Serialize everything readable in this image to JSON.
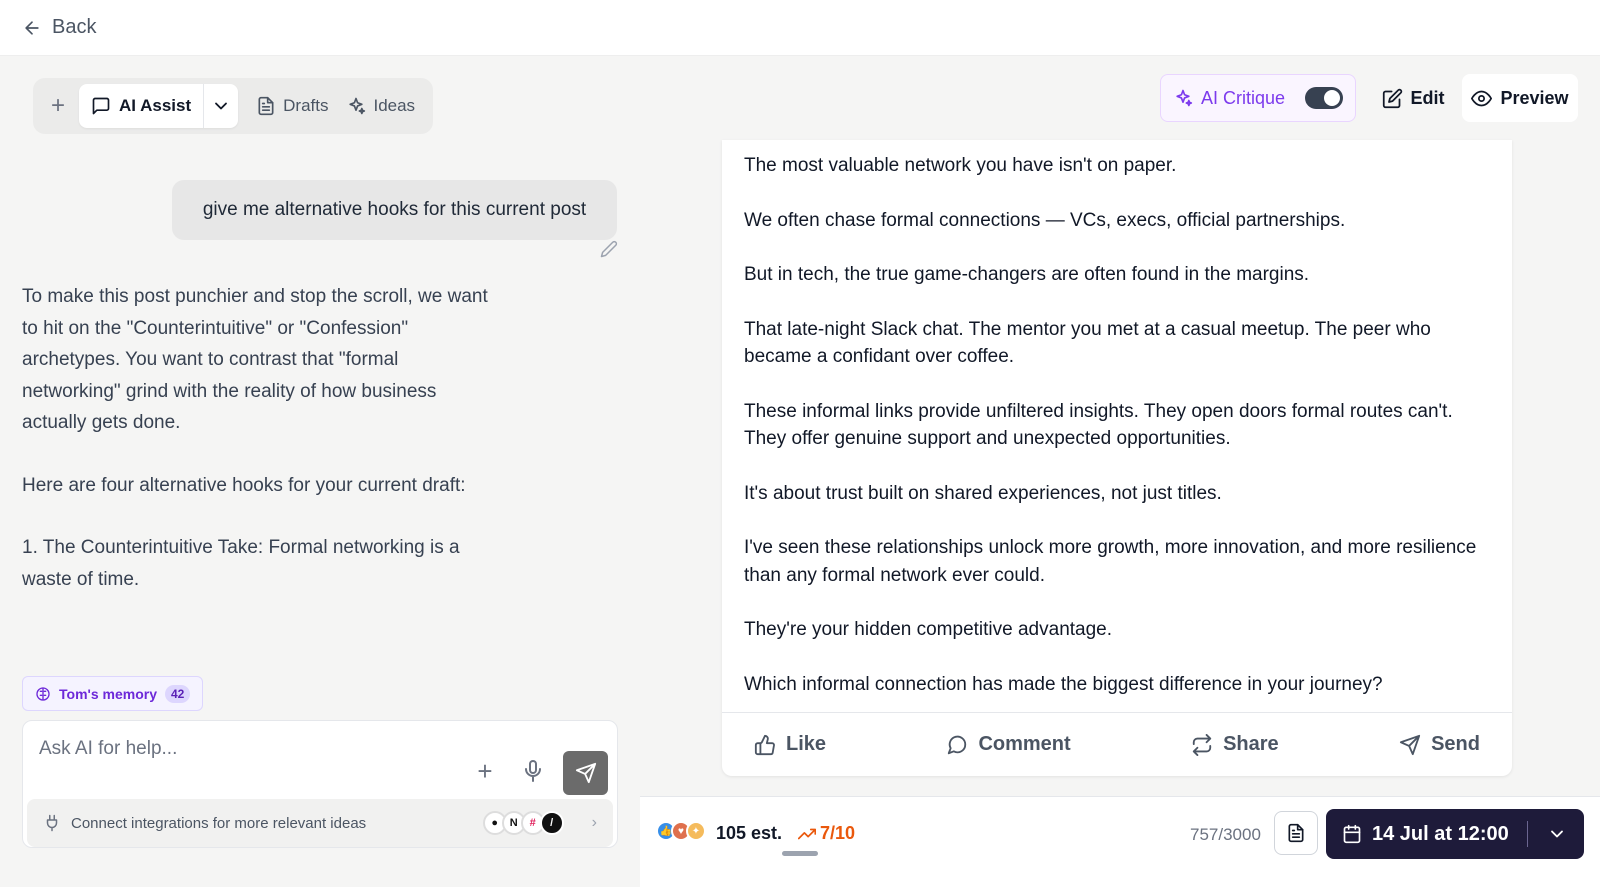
{
  "topbar": {
    "back_label": "Back"
  },
  "toolbar": {
    "assist_label": "AI Assist",
    "drafts_label": "Drafts",
    "ideas_label": "Ideas"
  },
  "chat": {
    "user_message": "give me alternative hooks for this current post",
    "assistant_paragraphs": [
      "To make this post punchier and stop the scroll, we want to hit on the \"Counterintuitive\" or \"Confession\" archetypes. You want to contrast that \"formal networking\" grind with the reality of how business actually gets done.",
      "Here are four alternative hooks for your current draft:",
      "1. The Counterintuitive Take: Formal networking is a waste of time."
    ]
  },
  "memory": {
    "label": "Tom's memory",
    "count": "42"
  },
  "composer": {
    "placeholder": "Ask AI for help...",
    "integrations_label": "Connect integrations for more relevant ideas"
  },
  "header_right": {
    "critique_label": "AI Critique",
    "critique_enabled": true,
    "edit_label": "Edit",
    "preview_label": "Preview"
  },
  "post": {
    "paragraphs": [
      "The most valuable network you have isn't on paper.",
      "We often chase formal connections — VCs, execs, official partnerships.",
      "But in tech, the true game-changers are often found in the margins.",
      "That late-night Slack chat. The mentor you met at a casual meetup. The peer who became a confidant over coffee.",
      "These informal links provide unfiltered insights. They open doors formal routes can't. They offer genuine support and unexpected opportunities.",
      "It's about trust built on shared experiences, not just titles.",
      "I've seen these relationships unlock more growth, more innovation, and more resilience than any formal network ever could.",
      "They're your hidden competitive advantage.",
      "Which informal connection has made the biggest difference in your journey?"
    ],
    "actions": {
      "like": "Like",
      "comment": "Comment",
      "share": "Share",
      "send": "Send"
    }
  },
  "footer": {
    "estimate": "105 est.",
    "score": "7/10",
    "char_count": "757/3000",
    "schedule_label": "14 Jul at 12:00"
  },
  "colors": {
    "accent_purple": "#7c3aed",
    "schedule_bg": "#1e1b3a",
    "score_orange": "#ea580c"
  }
}
